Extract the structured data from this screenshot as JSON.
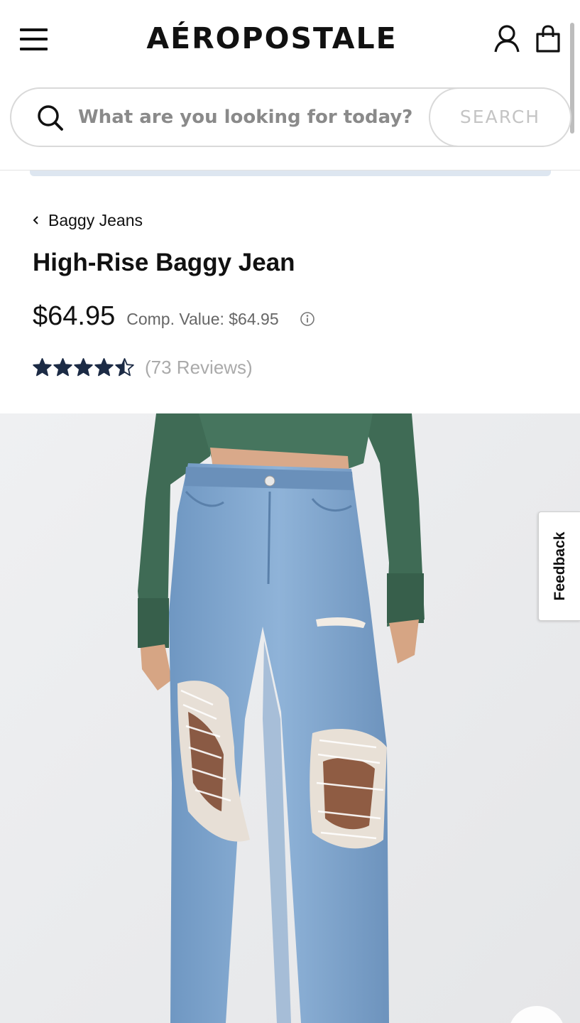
{
  "header": {
    "logo_text": "AÉROPOSTALE",
    "menu_icon": "hamburger-menu-icon",
    "account_icon": "user-account-icon",
    "bag_icon": "shopping-bag-icon"
  },
  "search": {
    "placeholder": "What are you looking for today?",
    "value": "",
    "button_label": "SEARCH",
    "icon": "search-icon"
  },
  "breadcrumb": {
    "label": "Baggy Jeans",
    "icon": "chevron-left-icon"
  },
  "product": {
    "title": "High-Rise Baggy Jean",
    "price": "$64.95",
    "comp_value": "Comp. Value: $64.95",
    "info_icon": "info-icon",
    "rating": 4.5,
    "rating_max": 5,
    "reviews_label": "(73 Reviews)"
  },
  "feedback": {
    "label": "Feedback"
  },
  "colors": {
    "text_primary": "#111111",
    "star_fill": "#1c2b45",
    "muted": "#8a8a8a",
    "promo_strip": "#dde6f0",
    "image_bg": "#eceeef",
    "sweater": "#3f6b55",
    "denim": "#7fa6cf"
  }
}
